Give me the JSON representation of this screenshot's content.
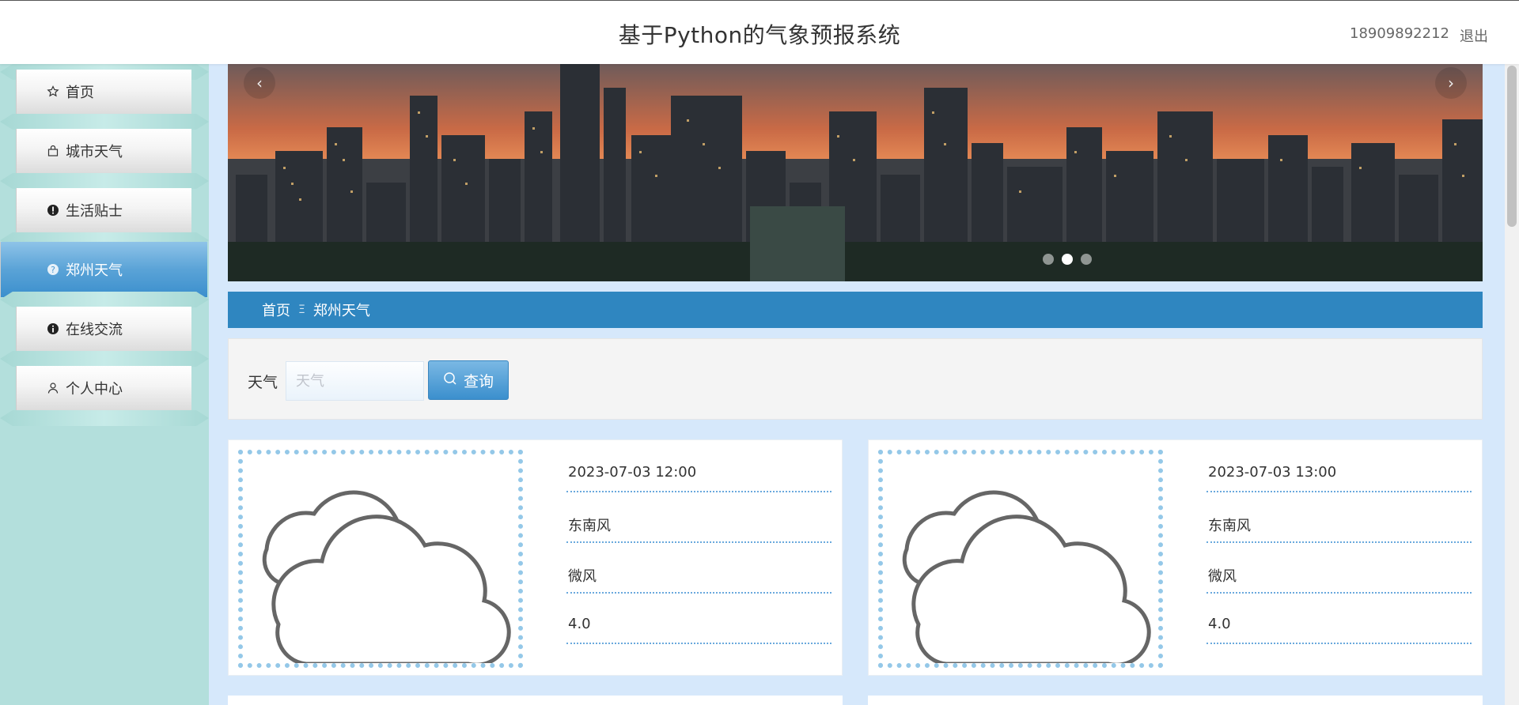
{
  "header": {
    "title": "基于Python的气象预报系统",
    "user": "18909892212",
    "logout": "退出"
  },
  "sidebar": {
    "items": [
      {
        "label": "首页",
        "icon": "star-icon"
      },
      {
        "label": "城市天气",
        "icon": "bag-icon"
      },
      {
        "label": "生活贴士",
        "icon": "exclamation-icon"
      },
      {
        "label": "郑州天气",
        "icon": "question-icon",
        "active": true
      },
      {
        "label": "在线交流",
        "icon": "info-icon"
      },
      {
        "label": "个人中心",
        "icon": "user-icon"
      }
    ]
  },
  "banner": {
    "prev": "‹",
    "next": "›",
    "slide_count": 3,
    "active_slide": 2
  },
  "breadcrumb": {
    "home": "首页",
    "separator": "Ξ",
    "current": "郑州天气"
  },
  "search": {
    "label": "天气",
    "placeholder": "天气",
    "value": "",
    "button": "查询"
  },
  "weather": [
    {
      "time": "2023-07-03 12:00",
      "direction": "东南风",
      "power": "微风",
      "value": "4.0",
      "icon": "cloudy-icon"
    },
    {
      "time": "2023-07-03 13:00",
      "direction": "东南风",
      "power": "微风",
      "value": "4.0",
      "icon": "cloudy-icon"
    }
  ],
  "colors": {
    "accent": "#2f86c0",
    "sidebar_bg": "#b3dfdc",
    "page_bg": "#d6e8fb",
    "active_nav": "#5aa3d7"
  }
}
